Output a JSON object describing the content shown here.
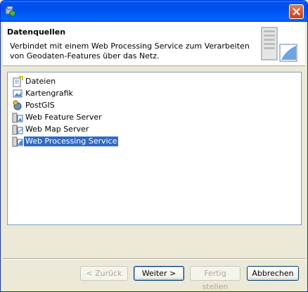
{
  "window": {
    "close_icon": "close-icon"
  },
  "header": {
    "title": "Datenquellen",
    "description": "Verbindet mit einem Web Processing Service zum Verarbeiten von Geodaten-Features über das Netz."
  },
  "list": {
    "items": [
      {
        "label": "Dateien",
        "icon": "folder-file-icon",
        "selected": false
      },
      {
        "label": "Kartengrafik",
        "icon": "map-image-icon",
        "selected": false
      },
      {
        "label": "PostGIS",
        "icon": "database-icon",
        "selected": false
      },
      {
        "label": "Web Feature Server",
        "icon": "web-feature-server-icon",
        "selected": false
      },
      {
        "label": "Web Map Server",
        "icon": "web-map-server-icon",
        "selected": false
      },
      {
        "label": "Web Processing Service",
        "icon": "web-processing-service-icon",
        "selected": true
      }
    ],
    "selection_color": "#316ac5"
  },
  "buttons": {
    "back": "< Zurück",
    "next": "Weiter >",
    "finish": "Fertig stellen",
    "cancel": "Abbrechen"
  }
}
